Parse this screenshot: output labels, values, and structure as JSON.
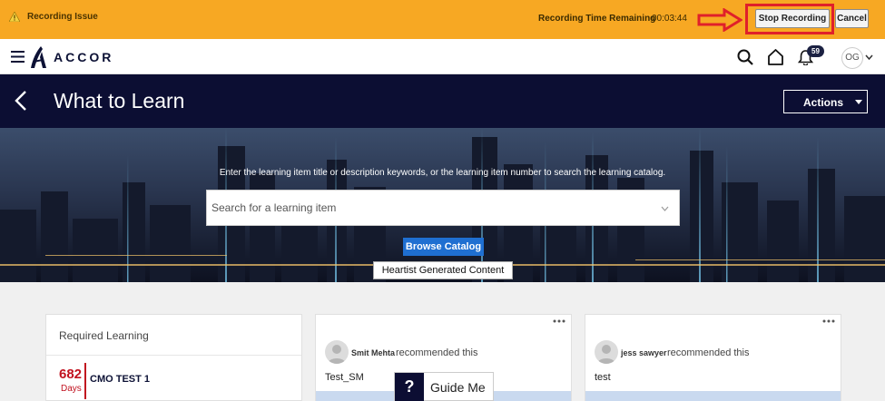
{
  "recording_bar": {
    "issue_label": "Recording Issue",
    "remaining_label": "Recording Time Remaining",
    "remaining_time": "00:03:44",
    "stop_label": "Stop Recording",
    "cancel_label": "Cancel",
    "colors": {
      "bar": "#f7a823",
      "highlight": "#e0202a"
    }
  },
  "topnav": {
    "brand": "ACCOR",
    "notification_count": "59",
    "user_initials": "OG",
    "icons": [
      "hamburger-icon",
      "accor-logo",
      "search-icon",
      "home-icon",
      "bell-icon",
      "chevron-down-icon"
    ]
  },
  "header": {
    "title": "What to Learn",
    "actions_label": "Actions"
  },
  "hero": {
    "caption": "Enter the learning item title or description keywords, or the learning item number to search the learning catalog.",
    "search_placeholder": "Search for a learning item",
    "browse_label": "Browse Catalog",
    "tag_label": "Heartist Generated Content"
  },
  "required_learning": {
    "title": "Required Learning",
    "items": [
      {
        "days": "682",
        "days_label": "Days",
        "name": "CMO TEST 1"
      }
    ]
  },
  "recommendations": [
    {
      "user": "Smit Mehta",
      "action": "recommended this",
      "item": "Test_SM"
    },
    {
      "user": "jess sawyer",
      "action": "recommended this",
      "item": "test"
    }
  ],
  "guide": {
    "icon": "?",
    "label": "Guide Me"
  }
}
